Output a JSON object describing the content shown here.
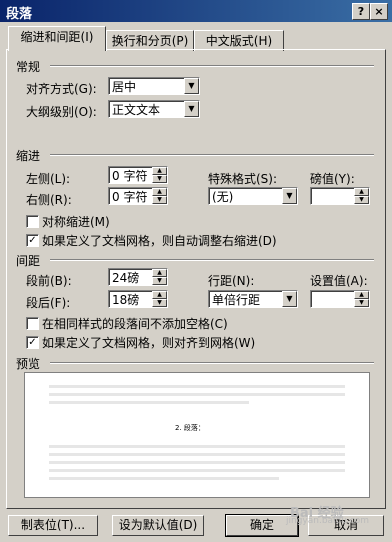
{
  "window": {
    "title": "段落",
    "help": "?",
    "close": "×"
  },
  "tabs": [
    "缩进和间距(I)",
    "换行和分页(P)",
    "中文版式(H)"
  ],
  "general": {
    "section": "常规",
    "alignment_label": "对齐方式(G):",
    "alignment_value": "居中",
    "outline_label": "大纲级别(O):",
    "outline_value": "正文文本"
  },
  "indent": {
    "section": "缩进",
    "left_label": "左侧(L):",
    "left_value": "0 字符",
    "right_label": "右侧(R):",
    "right_value": "0 字符",
    "special_label": "特殊格式(S):",
    "special_value": "(无)",
    "by_label": "磅值(Y):",
    "by_value": "",
    "mirror_label": "对称缩进(M)",
    "mirror_checked": false,
    "grid_label": "如果定义了文档网格，则自动调整右缩进(D)",
    "grid_checked": true
  },
  "spacing": {
    "section": "间距",
    "before_label": "段前(B):",
    "before_value": "24磅",
    "after_label": "段后(F):",
    "after_value": "18磅",
    "line_label": "行距(N):",
    "line_value": "单倍行距",
    "at_label": "设置值(A):",
    "at_value": "",
    "noadd_label": "在相同样式的段落间不添加空格(C)",
    "noadd_checked": false,
    "snap_label": "如果定义了文档网格，则对齐到网格(W)",
    "snap_checked": true
  },
  "preview": {
    "section": "预览",
    "sample": "2. 段落："
  },
  "buttons": {
    "tabs": "制表位(T)...",
    "default": "设为默认值(D)",
    "ok": "确定",
    "cancel": "取消"
  },
  "watermark": {
    "text": "Bai 经验",
    "url": "jingyan.baidu.com"
  }
}
